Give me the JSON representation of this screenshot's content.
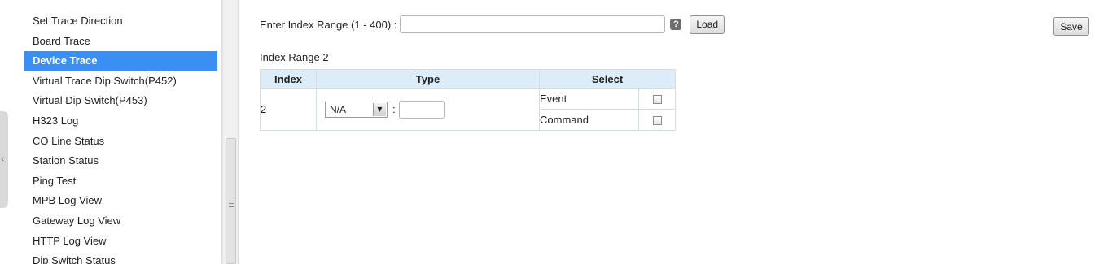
{
  "sidebar": {
    "items": [
      {
        "label": "Set Trace Direction"
      },
      {
        "label": "Board Trace"
      },
      {
        "label": "Device Trace",
        "active": true
      },
      {
        "label": "Virtual Trace Dip Switch(P452)"
      },
      {
        "label": "Virtual Dip Switch(P453)"
      },
      {
        "label": "H323 Log"
      },
      {
        "label": "CO Line Status"
      },
      {
        "label": "Station Status"
      },
      {
        "label": "Ping Test"
      },
      {
        "label": "MPB Log View"
      },
      {
        "label": "Gateway Log View"
      },
      {
        "label": "HTTP Log View"
      },
      {
        "label": "Dip Switch Status"
      }
    ],
    "collapse_icon": "chevron-left-icon"
  },
  "main": {
    "range_label": "Enter Index Range (1 - 400) :",
    "range_value": "",
    "help_icon": "?",
    "load_label": "Load",
    "save_label": "Save",
    "section_title": "Index Range 2",
    "table": {
      "headers": [
        "Index",
        "Type",
        "Select"
      ],
      "row": {
        "index": "2",
        "type_selected": "N/A",
        "colon": ":",
        "type_value": "",
        "options": [
          {
            "label": "Event",
            "checked": false
          },
          {
            "label": "Command",
            "checked": false
          }
        ]
      }
    }
  },
  "colors": {
    "accent": "#3a8ff5",
    "table_header": "#dcecf8"
  }
}
